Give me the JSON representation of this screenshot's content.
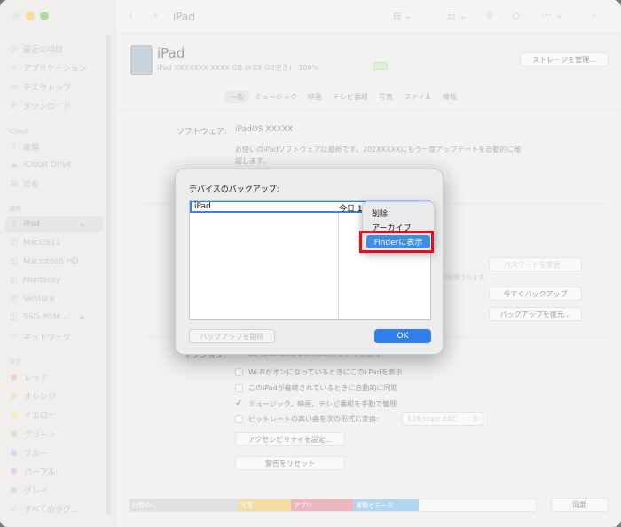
{
  "window": {
    "title": "iPad"
  },
  "sidebar": {
    "favorites": [
      {
        "label": "最近の項目",
        "icon": "clock-icon"
      },
      {
        "label": "アプリケーション",
        "icon": "applications-icon"
      },
      {
        "label": "デスクトップ",
        "icon": "desktop-icon"
      },
      {
        "label": "ダウンロード",
        "icon": "download-icon"
      }
    ],
    "icloud_header": "iCloud",
    "icloud": [
      {
        "label": "書類",
        "icon": "document-icon"
      },
      {
        "label": "iCloud Drive",
        "icon": "cloud-icon"
      },
      {
        "label": "共有",
        "icon": "shared-folder-icon"
      }
    ],
    "locations_header": "場所",
    "locations": [
      {
        "label": "iPad",
        "icon": "ipad-icon"
      },
      {
        "label": "MacOS11",
        "icon": "disk-icon"
      },
      {
        "label": "Macintosh HD",
        "icon": "disk-icon"
      },
      {
        "label": "Monterey",
        "icon": "disk-icon"
      },
      {
        "label": "Ventura",
        "icon": "disk-icon"
      },
      {
        "label": "SSD-PGM...",
        "icon": "disk-icon"
      },
      {
        "label": "ネットワーク",
        "icon": "network-icon"
      }
    ],
    "tags_header": "タグ",
    "tags": [
      {
        "label": "レッド",
        "color": "#f0a7a3"
      },
      {
        "label": "オレンジ",
        "color": "#f4c39a"
      },
      {
        "label": "イエロー",
        "color": "#f2dc8d"
      },
      {
        "label": "グリーン",
        "color": "#a8d9a0"
      },
      {
        "label": "ブルー",
        "color": "#9cc2ef"
      },
      {
        "label": "パープル",
        "color": "#cfa8e3"
      },
      {
        "label": "グレイ",
        "color": "#c4c4c4"
      },
      {
        "label": "すべてのタグ...",
        "color": "#d8d8d8"
      }
    ]
  },
  "device": {
    "name": "iPad",
    "details": "iPad  XXXXXXX  XXXX GB (XXX GB空き) · 100%",
    "manage_storage": "ストレージを管理..."
  },
  "tabs": [
    "一般",
    "ミュージック",
    "映画",
    "テレビ番組",
    "写真",
    "ファイル",
    "情報"
  ],
  "general": {
    "software_label": "ソフトウェア:",
    "software_value": "iPadOS XXXXX",
    "software_msg1": "お使いのiPadソフトウェアは最新です。202XXXXXにもう一度アップデートを自動的に確",
    "software_msg2": "認します。",
    "change_password": "パスワードを変更...",
    "encrypted_note": "が保護されます。",
    "backup_now": "今すぐバックアップ",
    "restore_backup": "バックアップを復元...",
    "options_label": "オプション:",
    "opt_sd": "SD (Standard Definition) ビデオを優先",
    "opt_wifi": "Wi-Fiがオンになっているときにこのi Padを表示",
    "opt_autosync": "このiPadが接続されているときに自動的に同期",
    "opt_manual": "ミュージック、映画、テレビ番組を手動で管理",
    "opt_bitrate": "ビットレートの高い曲を次の形式に変換:",
    "bitrate_value": "128 kbps AAC",
    "accessibility": "アクセシビリティを設定...",
    "reset_warnings": "警告をリセット"
  },
  "storage_bar": {
    "segments": [
      {
        "label": "計算中...",
        "color": "#c9c9c9"
      },
      {
        "label": "写真",
        "color": "#e8c25e"
      },
      {
        "label": "アプリ",
        "color": "#e07d8a"
      },
      {
        "label": "書類とデータ",
        "color": "#72b4e4"
      },
      {
        "label": "",
        "color": "#f5f5f5"
      }
    ],
    "sync_button": "同期"
  },
  "dialog": {
    "title": "デバイスのバックアップ:",
    "row_name": "iPad",
    "row_date": "今日 14",
    "delete_button": "バックアップを削除",
    "ok_button": "OK"
  },
  "context_menu": {
    "items": [
      "削除",
      "アーカイブ",
      "Finderに表示"
    ]
  },
  "colors": {
    "accent": "#3a8ee6",
    "highlight_box": "#e0101c"
  }
}
